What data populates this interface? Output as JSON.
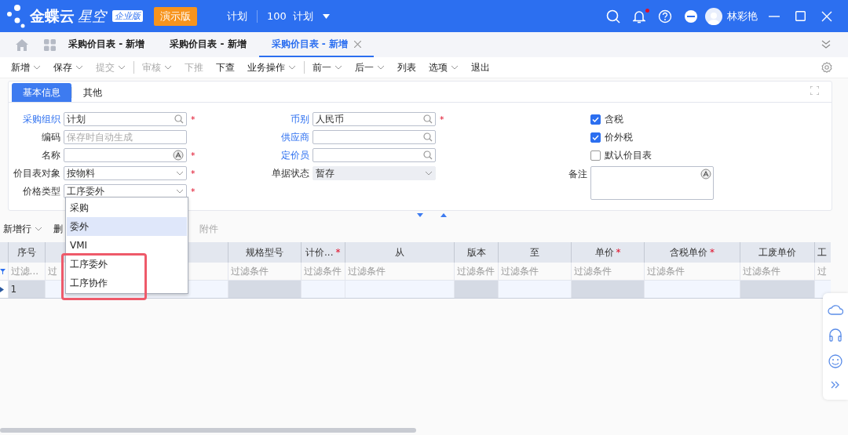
{
  "app": {
    "brand": "金蝶云",
    "brand_suffix": "星空",
    "edition": "企业版",
    "demo_badge": "演示版",
    "org": "计划",
    "data_center": "100  计划",
    "user": "林彩艳",
    "has_notification": true
  },
  "page_tabs": [
    {
      "label": "采购价目表 - 新增",
      "selected": false
    },
    {
      "label": "采购价目表 - 新增",
      "selected": false
    },
    {
      "label": "采购价目表 - 新增",
      "selected": true
    }
  ],
  "toolbar": [
    {
      "kind": "button",
      "label": "新增",
      "dropdown": true,
      "disabled": false
    },
    {
      "kind": "button",
      "label": "保存",
      "dropdown": true,
      "disabled": false
    },
    {
      "kind": "button",
      "label": "提交",
      "dropdown": true,
      "disabled": true
    },
    {
      "kind": "separator"
    },
    {
      "kind": "button",
      "label": "审核",
      "dropdown": true,
      "disabled": true
    },
    {
      "kind": "button",
      "label": "下推",
      "dropdown": false,
      "disabled": true
    },
    {
      "kind": "button",
      "label": "下查",
      "dropdown": false,
      "disabled": false
    },
    {
      "kind": "button",
      "label": "业务操作",
      "dropdown": true,
      "disabled": false
    },
    {
      "kind": "separator"
    },
    {
      "kind": "button",
      "label": "前一",
      "dropdown": true,
      "disabled": false
    },
    {
      "kind": "button",
      "label": "后一",
      "dropdown": true,
      "disabled": false
    },
    {
      "kind": "button",
      "label": "列表",
      "dropdown": false,
      "disabled": false
    },
    {
      "kind": "button",
      "label": "选项",
      "dropdown": true,
      "disabled": false
    },
    {
      "kind": "button",
      "label": "退出",
      "dropdown": false,
      "disabled": false
    }
  ],
  "form_tabs": [
    {
      "label": "基本信息",
      "selected": true
    },
    {
      "label": "其他",
      "selected": false
    }
  ],
  "form_left": [
    {
      "label": "采购组织",
      "link": true,
      "kind": "lookup",
      "value": "计划",
      "required_mark": "*"
    },
    {
      "label": "编码",
      "link": false,
      "kind": "text",
      "placeholder": "保存时自动生成"
    },
    {
      "label": "名称",
      "link": false,
      "kind": "multilang",
      "required_mark": "*"
    },
    {
      "label": "价目表对象",
      "link": false,
      "kind": "select",
      "value": "按物料",
      "required_mark": "*"
    },
    {
      "label": "价格类型",
      "link": false,
      "kind": "select",
      "value": "工序委外",
      "required_mark": "*"
    }
  ],
  "form_middle": [
    {
      "label": "币别",
      "link": true,
      "kind": "lookup",
      "value": "人民币",
      "required_mark": "*"
    },
    {
      "label": "供应商",
      "link": true,
      "kind": "lookup"
    },
    {
      "label": "定价员",
      "link": true,
      "kind": "lookup"
    },
    {
      "label": "单据状态",
      "link": false,
      "kind": "select",
      "value": "暂存",
      "disabled": true
    }
  ],
  "form_right": {
    "checkboxes": [
      {
        "label": "含税",
        "checked": true
      },
      {
        "label": "价外税",
        "checked": true
      },
      {
        "label": "默认价目表",
        "checked": false
      }
    ],
    "remark": {
      "label": "备注"
    }
  },
  "dropdown": {
    "options": [
      {
        "label": "采购",
        "highlighted": false
      },
      {
        "label": "委外",
        "highlighted": true
      },
      {
        "label": "VMI",
        "highlighted": false
      },
      {
        "label": "工序委外",
        "highlighted": false
      },
      {
        "label": "工序协作",
        "highlighted": false
      }
    ],
    "highlight_frame": true
  },
  "grid_toolbar": [
    {
      "label": "新增行",
      "dropdown": true,
      "disabled": false
    },
    {
      "label": "删",
      "dropdown": false,
      "disabled": false
    },
    {
      "label": "附件",
      "dropdown": false,
      "disabled": true
    }
  ],
  "table": {
    "columns": [
      {
        "label": "序号",
        "filter": "过滤...",
        "readonly": true
      },
      {
        "filter": "过",
        "readonly": false
      },
      {
        "label": "规格型号",
        "filter": "过滤条件",
        "readonly": true
      },
      {
        "label": "计价...",
        "filter": "过滤条件",
        "readonly": false,
        "required_mark": "*"
      },
      {
        "label": "从",
        "filter": "过滤条件",
        "readonly": false
      },
      {
        "label": "版本",
        "filter": "过滤条件",
        "readonly": true
      },
      {
        "label": "至",
        "filter": "过滤条件",
        "readonly": false
      },
      {
        "label": "单价",
        "filter": "过滤条件",
        "readonly": true,
        "required_mark": "*"
      },
      {
        "label": "含税单价",
        "filter": "过滤条件",
        "readonly": false,
        "required_mark": "*"
      },
      {
        "label": "工废单价",
        "filter": "过滤条件",
        "readonly": true
      },
      {
        "label": "工",
        "filter": "过",
        "readonly": false
      }
    ],
    "rows": [
      {
        "seq": "1"
      }
    ]
  }
}
